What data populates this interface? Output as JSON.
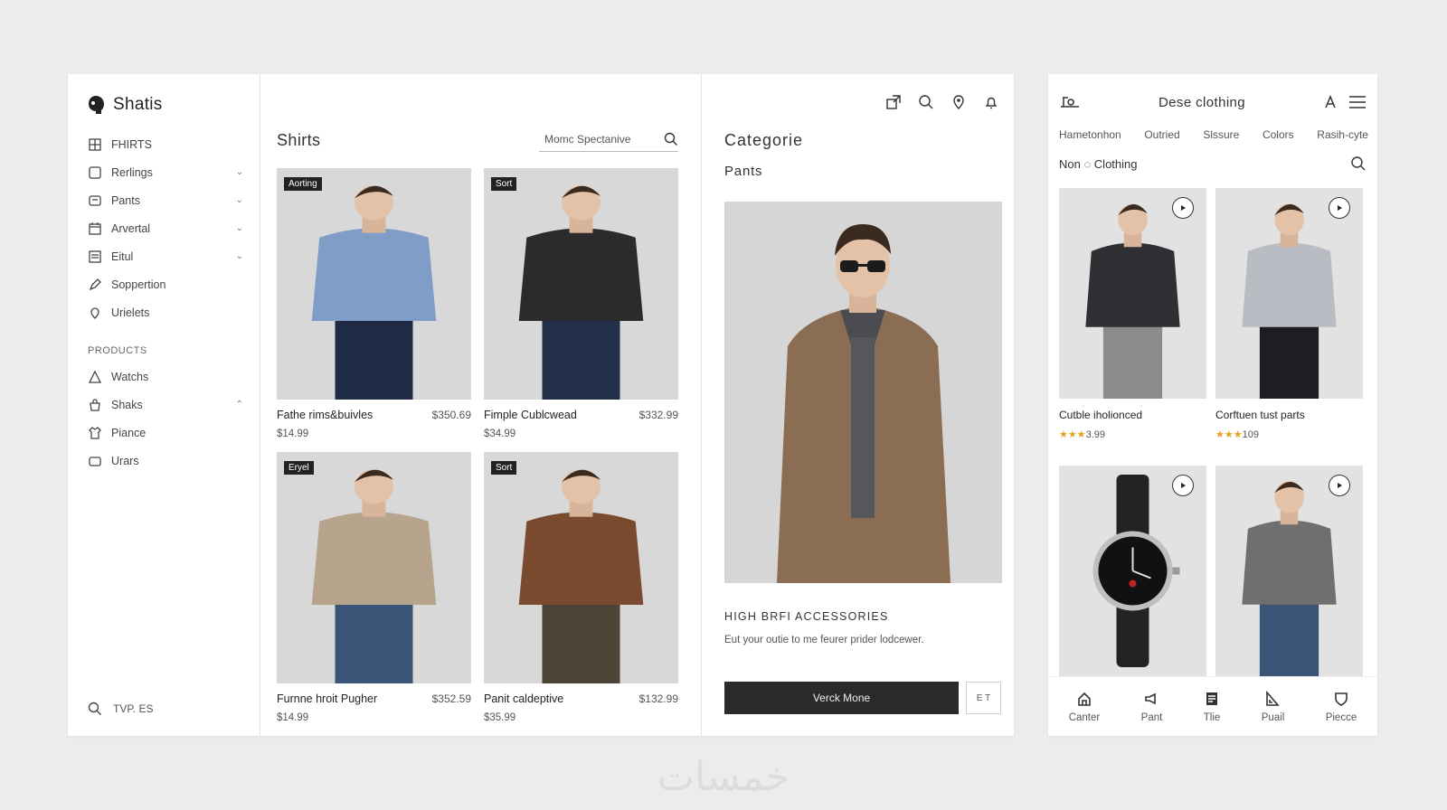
{
  "colors": {
    "accent": "#2a2a2a",
    "star": "#e3a21a",
    "background": "#ececec"
  },
  "brand": {
    "name": "Shatis",
    "icon": "brand-logo-icon"
  },
  "sidebar": {
    "items": [
      {
        "label": "FHIRTS",
        "icon": "grid-icon",
        "chevron": ""
      },
      {
        "label": "Rerlings",
        "icon": "square-icon",
        "chevron": "⌄"
      },
      {
        "label": "Pants",
        "icon": "tag-icon",
        "chevron": "⌄"
      },
      {
        "label": "Arvertal",
        "icon": "calendar-icon",
        "chevron": "⌄"
      },
      {
        "label": "Eitul",
        "icon": "list-icon",
        "chevron": "⌄"
      },
      {
        "label": "Soppertion",
        "icon": "pen-icon",
        "chevron": ""
      },
      {
        "label": "Urielets",
        "icon": "pin-icon",
        "chevron": ""
      }
    ],
    "section_label": "PRODUCTS",
    "products": [
      {
        "label": "Watchs",
        "icon": "triangle-icon",
        "chevron": ""
      },
      {
        "label": "Shaks",
        "icon": "bag-icon",
        "chevron": "⌃"
      },
      {
        "label": "Piance",
        "icon": "tshirt-icon",
        "chevron": ""
      },
      {
        "label": "Urars",
        "icon": "box-icon",
        "chevron": ""
      }
    ],
    "search_label": "TVP. ES"
  },
  "products": {
    "title": "Shirts",
    "search_placeholder": "Momc Spectanive",
    "cards": [
      {
        "badge": "Aorting",
        "name": "Fathe rims&buivles",
        "price": "$350.69",
        "sub": "$14.99",
        "shirt": "#7f9dc6",
        "pants": "#1f2a44"
      },
      {
        "badge": "Sort",
        "name": "Fimple Cublcwead",
        "price": "$332.99",
        "sub": "$34.99",
        "shirt": "#2b2b2d",
        "pants": "#22304a"
      },
      {
        "badge": "Eryel",
        "name": "Furnne hroit Pugher",
        "price": "$352.59",
        "sub": "$14.99",
        "shirt": "#b6a48c",
        "pants": "#3a5478"
      },
      {
        "badge": "Sort",
        "name": "Panit caldeptive",
        "price": "$132.99",
        "sub": "$35.99",
        "shirt": "#7a4a2e",
        "pants": "#4d4438"
      }
    ]
  },
  "category": {
    "title": "Categorie",
    "subtitle": "Pants",
    "heading": "HIGH BRFI ACCESSORIES",
    "description": "Eut your outie to me feurer prider lodcewer.",
    "button_label": "Verck Mone",
    "button2_label": "E T",
    "jacket_color": "#8a6d52"
  },
  "side": {
    "title": "Dese clothing",
    "tabs": [
      "Hametonhon",
      "Outried",
      "Slssure",
      "Colors",
      "Rasih-cyte"
    ],
    "filter_label": "Non ◌ Clothing",
    "cards": [
      {
        "name": "Cutble iholionced",
        "stars": "★★★",
        "rating": "3.99",
        "kind": "person",
        "shirt": "#2f3033",
        "pants": "#8b8b8d"
      },
      {
        "name": "Corftuen tust parts",
        "stars": "★★★",
        "rating": "109",
        "kind": "person",
        "shirt": "#b9bcc2",
        "pants": "#1e1e22"
      },
      {
        "name": "",
        "stars": "",
        "rating": "",
        "kind": "watch"
      },
      {
        "name": "",
        "stars": "",
        "rating": "",
        "kind": "person",
        "shirt": "#6f6f6f",
        "pants": "#3a5478"
      }
    ],
    "bottom_nav": [
      {
        "label": "Canter",
        "icon": "home-icon"
      },
      {
        "label": "Pant",
        "icon": "megaphone-icon"
      },
      {
        "label": "Tlie",
        "icon": "document-icon"
      },
      {
        "label": "Puail",
        "icon": "ruler-icon"
      },
      {
        "label": "Piecce",
        "icon": "shield-icon"
      }
    ]
  },
  "watermark": "خمسات"
}
